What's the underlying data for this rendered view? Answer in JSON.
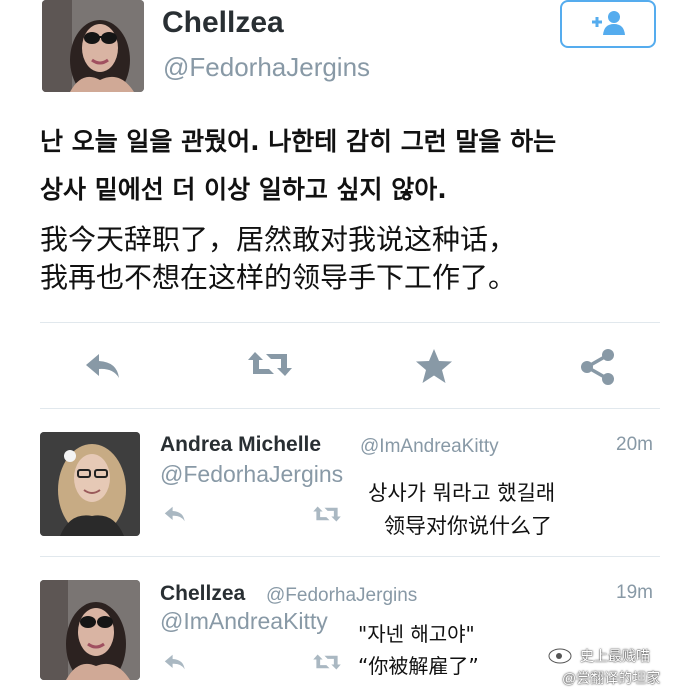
{
  "main_tweet": {
    "display_name": "Chellzea",
    "handle": "@FedorhaJergins",
    "text_ko_line1": "난 오늘 일을 관뒀어. 나한테 감히 그런 말을 하는",
    "text_ko_line2": "상사 밑에선 더 이상 일하고 싶지 않아.",
    "text_zh_line1": "我今天辞职了，居然敢对我说这种话，",
    "text_zh_line2": "我再也不想在这样的领导手下工作了。",
    "follow_icon": "add-user-icon",
    "actions": [
      "reply-icon",
      "retweet-icon",
      "favorite-icon",
      "share-icon"
    ]
  },
  "replies": [
    {
      "display_name": "Andrea Michelle",
      "handle": "@ImAndreaKitty",
      "time": "20m",
      "mention": "@FedorhaJergins",
      "caption_ko": "상사가 뭐라고 했길래",
      "caption_zh": "领导对你说什么了"
    },
    {
      "display_name": "Chellzea",
      "handle": "@FedorhaJergins",
      "time": "19m",
      "mention": "@ImAndreaKitty",
      "caption_ko": "\"자넨 해고야\"",
      "caption_zh": "“你被解雇了”"
    }
  ],
  "watermark": {
    "line1": "史上最贱喵",
    "line2": "@尝翻译的坦家"
  },
  "colors": {
    "accent": "#55acee",
    "muted": "#8899a6",
    "icon": "#8899a6"
  }
}
